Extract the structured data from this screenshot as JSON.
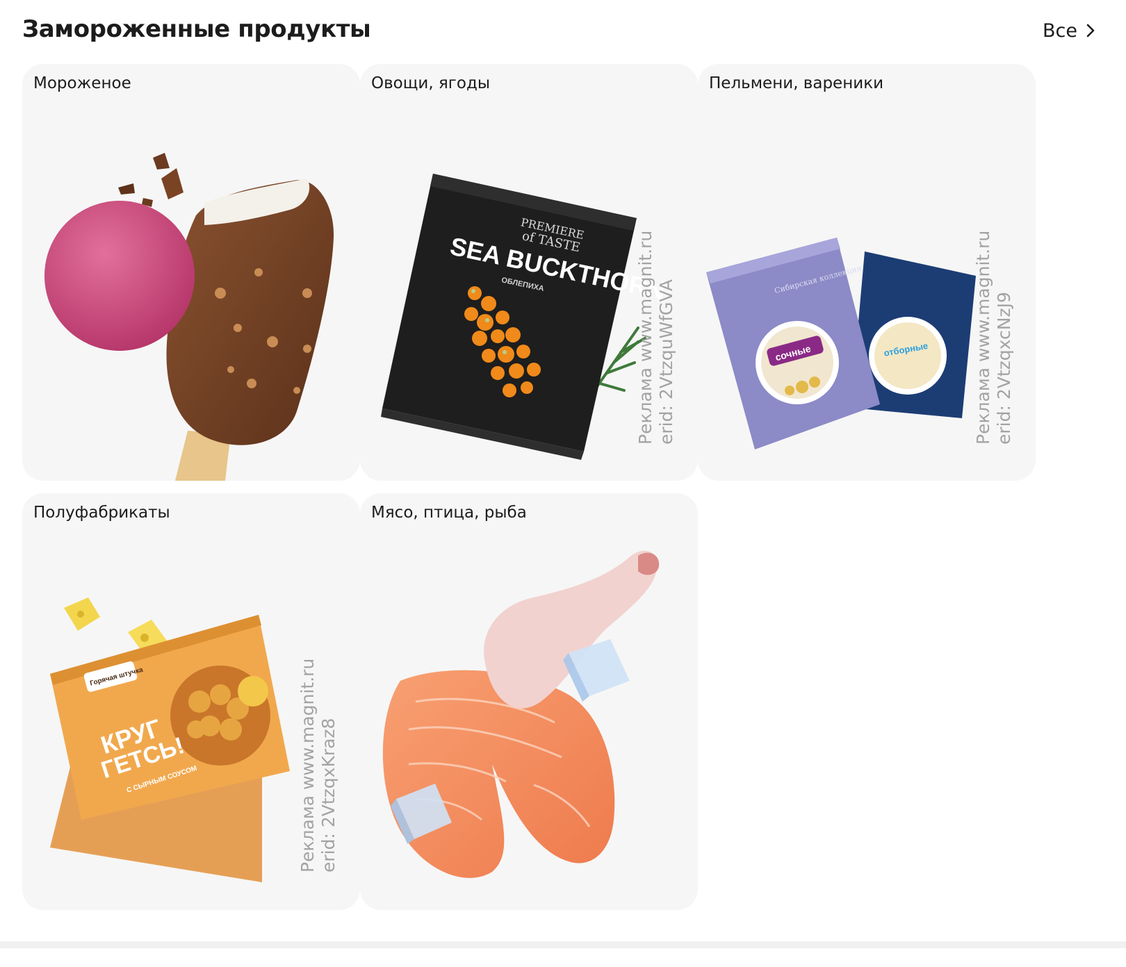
{
  "header": {
    "title": "Замороженные продукты",
    "all_label": "Все"
  },
  "categories": [
    {
      "label": "Мороженое"
    },
    {
      "label": "Овощи, ягоды",
      "ad": {
        "line1": "Реклама www.magnit.ru",
        "line2": "erid: 2VtzquWfGVA"
      },
      "package": {
        "brand_line1": "PREMIERE",
        "brand_line2": "of TASTE",
        "name": "SEA BUCKTHORN",
        "subname": "ОБЛЕПИХА"
      }
    },
    {
      "label": "Пельмени, вареники",
      "ad": {
        "line1": "Реклама www.magnit.ru",
        "line2": "erid: 2VtzqxcNzJ9"
      },
      "package": {
        "brand": "Сибирская коллекция",
        "left_label": "сочные",
        "right_label": "отборные"
      }
    },
    {
      "label": "Полуфабрикаты",
      "ad": {
        "line1": "Реклама www.magnit.ru",
        "line2": "erid: 2VtzqxKraz8"
      },
      "package": {
        "brand": "Горячая штучка",
        "name_line1": "КРУГ",
        "name_line2": "ГЕТСЬ!",
        "sub": "С СЫРНЫМ СОУСОМ"
      }
    },
    {
      "label": "Мясо, птица, рыба"
    }
  ],
  "icons": {
    "all_arrow": "chevron-right-icon"
  },
  "colors": {
    "card_bg": "#f6f6f6",
    "text": "#1c1c1c",
    "ad_text": "#a3a3a3"
  }
}
